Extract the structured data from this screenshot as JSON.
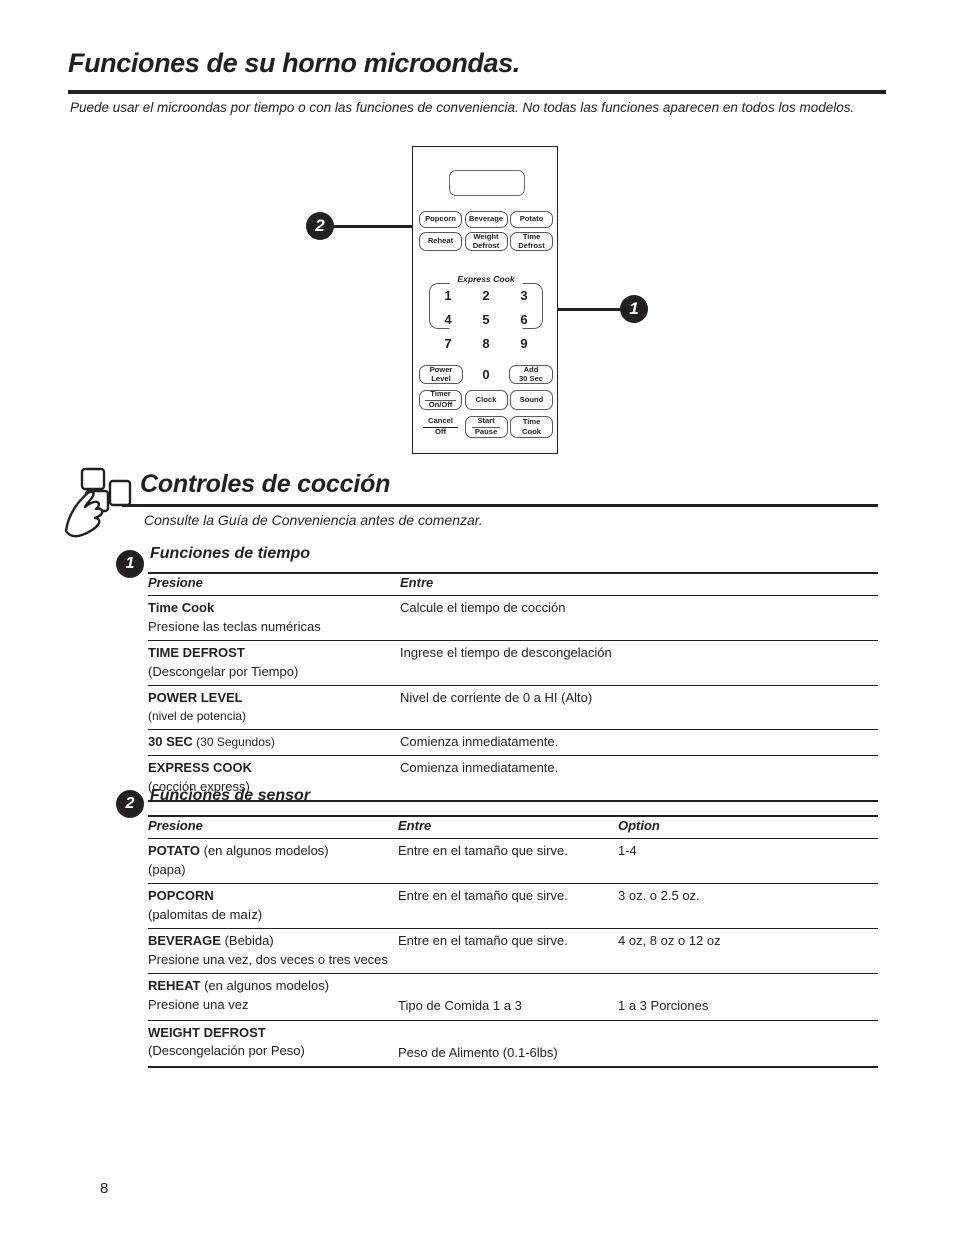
{
  "page": {
    "title": "Funciones de su horno microondas.",
    "subtitle": "Puede usar el microondas por tiempo o con las funciones de conveniencia. No todas las funciones aparecen en todos los modelos.",
    "number": "8"
  },
  "diagram": {
    "callouts": [
      {
        "id": "callout-2",
        "label": "2"
      },
      {
        "id": "callout-1",
        "label": "1"
      }
    ],
    "panel": {
      "display_value": "",
      "sensor_buttons_row1": [
        {
          "label": "Popcorn"
        },
        {
          "label": "Beverage"
        },
        {
          "label": "Potato"
        }
      ],
      "sensor_buttons_row2": [
        {
          "label": "Reheat"
        },
        {
          "label": "Weight\nDefrost"
        },
        {
          "label": "Time\nDefrost"
        }
      ],
      "express_cook_label": "Express Cook",
      "keypad": [
        [
          "1",
          "2",
          "3"
        ],
        [
          "4",
          "5",
          "6"
        ],
        [
          "7",
          "8",
          "9"
        ]
      ],
      "power_level": "Power\nLevel",
      "zero_key": "0",
      "add_30_sec": "Add\n30 Sec",
      "timer_on_off_top": "Timer",
      "timer_on_off_bottom": "On/Off",
      "clock": "Clock",
      "sound": "Sound",
      "cancel_top": "Cancel",
      "cancel_bottom": "Off",
      "start_top": "Start",
      "start_bottom": "Pause",
      "time_cook_top": "Time",
      "time_cook_bottom": "Cook"
    }
  },
  "section": {
    "heading": "Controles de cocción",
    "subheading": "Consulte la Guía de Conveniencia antes de comenzar."
  },
  "time_functions": {
    "badge": "1",
    "heading": "Funciones de tiempo",
    "columns": [
      "Presione",
      "Entre"
    ],
    "rows": [
      {
        "press_bold": "Time Cook",
        "press_note": "Presione las teclas numéricas",
        "enter": "Calcule el tiempo de cocción"
      },
      {
        "press_bold": "TIME DEFROST",
        "press_note": "(Descongelar por Tiempo)",
        "enter": "Ingrese el tiempo de descongelación"
      },
      {
        "press_bold": "POWER LEVEL",
        "press_note": "(nivel de potencia)",
        "enter": "Nivel de corriente de 0 a HI (Alto)"
      },
      {
        "press_bold": "30 SEC",
        "press_inline": " (30 Segundos)",
        "press_note": "",
        "enter": "Comienza inmediatamente."
      },
      {
        "press_bold": "EXPRESS COOK",
        "press_note": "(cocción express)",
        "enter": "Comienza inmediatamente."
      }
    ]
  },
  "sensor_functions": {
    "badge": "2",
    "heading": "Funciones de sensor",
    "columns": [
      "Presione",
      "Entre",
      "Option"
    ],
    "rows": [
      {
        "press_bold": "POTATO",
        "press_inline": " (en algunos modelos)",
        "press_note": "(papa)",
        "enter": "Entre en el tamaño que sirve.",
        "option": "1-4"
      },
      {
        "press_bold": "POPCORN",
        "press_inline": "",
        "press_note": "(palomitas de maíz)",
        "enter": "Entre en el tamaño que sirve.",
        "option": "3 oz. o 2.5 oz."
      },
      {
        "press_bold": "BEVERAGE",
        "press_inline": " (Bebida)",
        "press_note": "Presione una vez, dos veces o tres veces",
        "enter": "Entre en el tamaño que sirve.",
        "option": "4 oz, 8 oz o 12 oz"
      },
      {
        "press_bold": "REHEAT",
        "press_inline": " (en algunos modelos)",
        "press_note": "Presione una vez",
        "enter": "Tipo de Comida 1 a 3",
        "option": "1 a 3 Porciones",
        "enter_offset": true
      },
      {
        "press_bold": "WEIGHT DEFROST",
        "press_inline": "",
        "press_note": "(Descongelación por Peso)",
        "enter": "Peso de Alimento (0.1-6lbs)",
        "option": "",
        "enter_offset": true
      }
    ]
  }
}
